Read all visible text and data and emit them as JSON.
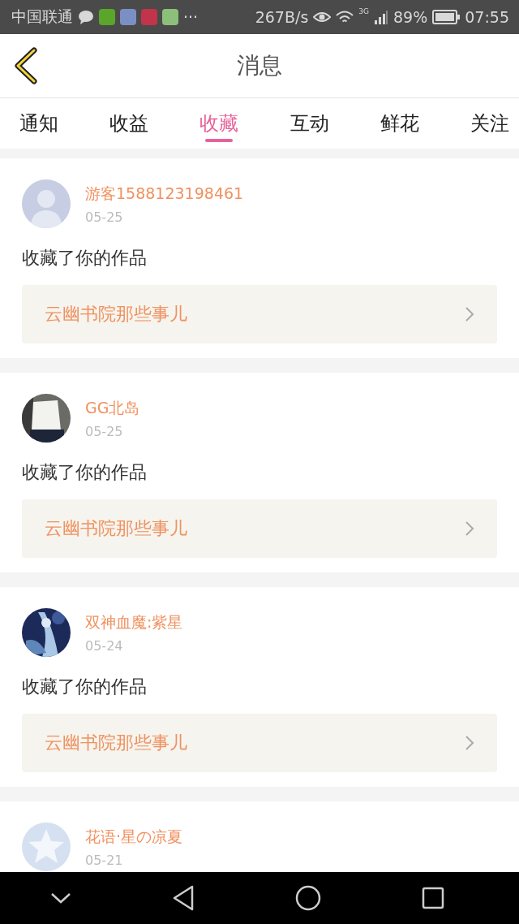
{
  "status_bar": {
    "carrier": "中国联通",
    "more": "···",
    "speed": "267B/s",
    "network": "3G",
    "battery": "89%",
    "time": "07:55"
  },
  "header": {
    "title": "消息"
  },
  "tabs": [
    {
      "label": "通知",
      "selected": false
    },
    {
      "label": "收益",
      "selected": false
    },
    {
      "label": "收藏",
      "selected": true
    },
    {
      "label": "互动",
      "selected": false
    },
    {
      "label": "鲜花",
      "selected": false
    },
    {
      "label": "关注",
      "selected": false
    }
  ],
  "messages": [
    {
      "avatar": {
        "kind": "default"
      },
      "name": "游客1588123198461",
      "date": "05-25",
      "text": "收藏了你的作品",
      "work": "云幽书院那些事儿"
    },
    {
      "name": "GG北岛",
      "date": "05-25",
      "text": "收藏了你的作品",
      "work": "云幽书院那些事儿"
    },
    {
      "name": "双神血魔:紫星",
      "date": "05-24",
      "text": "收藏了你的作品",
      "work": "云幽书院那些事儿"
    },
    {
      "avatar": {
        "kind": "star"
      },
      "name": "花语·星の凉夏",
      "date": "05-21"
    }
  ]
}
